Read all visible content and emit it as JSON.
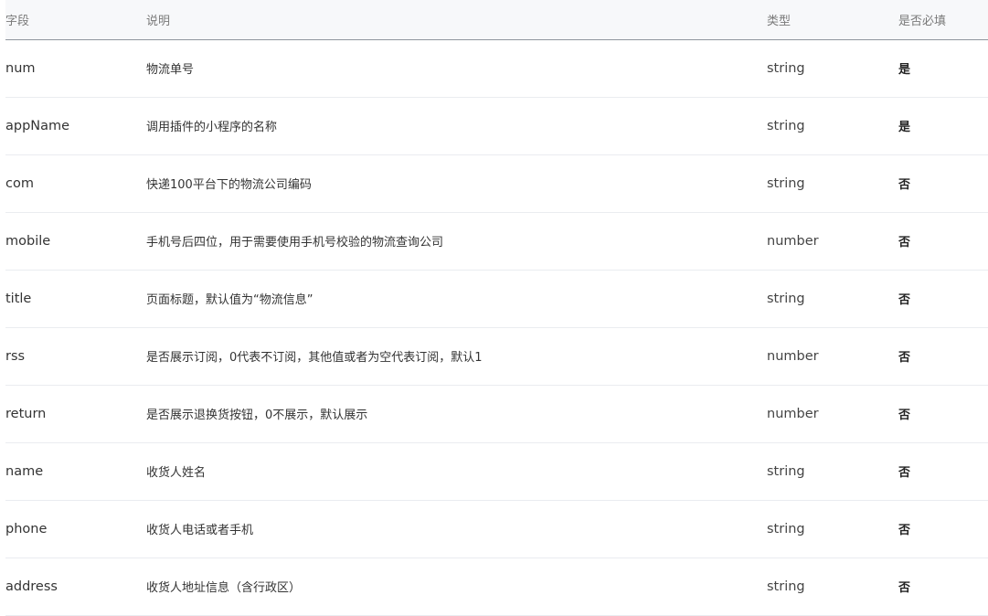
{
  "table": {
    "headers": [
      "字段",
      "说明",
      "类型",
      "是否必填"
    ],
    "rows": [
      {
        "field": "num",
        "desc": "物流单号",
        "type": "string",
        "required": "是"
      },
      {
        "field": "appName",
        "desc": "调用插件的小程序的名称",
        "type": "string",
        "required": "是"
      },
      {
        "field": "com",
        "desc": "快递100平台下的物流公司编码",
        "type": "string",
        "required": "否"
      },
      {
        "field": "mobile",
        "desc": "手机号后四位，用于需要使用手机号校验的物流查询公司",
        "type": "number",
        "required": "否"
      },
      {
        "field": "title",
        "desc": "页面标题，默认值为“物流信息”",
        "type": "string",
        "required": "否"
      },
      {
        "field": "rss",
        "desc": "是否展示订阅，0代表不订阅，其他值或者为空代表订阅，默认1",
        "type": "number",
        "required": "否"
      },
      {
        "field": "return",
        "desc": "是否展示退换货按钮，0不展示，默认展示",
        "type": "number",
        "required": "否"
      },
      {
        "field": "name",
        "desc": "收货人姓名",
        "type": "string",
        "required": "否"
      },
      {
        "field": "phone",
        "desc": "收货人电话或者手机",
        "type": "string",
        "required": "否"
      },
      {
        "field": "address",
        "desc": "收货人地址信息（含行政区）",
        "type": "string",
        "required": "否"
      }
    ]
  }
}
